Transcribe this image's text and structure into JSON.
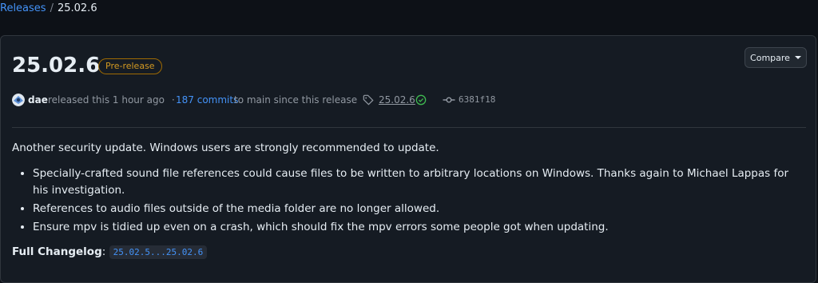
{
  "breadcrumb": {
    "parent": "Releases",
    "separator": "/",
    "current": "25.02.6"
  },
  "release": {
    "title": "25.02.6",
    "badge": "Pre-release",
    "compare_label": "Compare",
    "author": "dae",
    "released_text": "released this 1 hour ago",
    "dot": "·",
    "commits_link": "187 commits",
    "commits_suffix": "to main since this release",
    "tag": "25.02.6",
    "commit_sha": "6381f18"
  },
  "notes": {
    "intro": "Another security update. Windows users are strongly recommended to update.",
    "bullets": [
      "Specially-crafted sound file references could cause files to be written to arbitrary locations on Windows. Thanks again to Michael Lappas for his investigation.",
      "References to audio files outside of the media folder are no longer allowed.",
      "Ensure mpv is tidied up even on a crash, which should fix the mpv errors some people got when updating."
    ],
    "changelog_label": "Full Changelog",
    "changelog_colon": ":",
    "changelog_link": "25.02.5...25.02.6"
  },
  "colors": {
    "accent": "#4493f8",
    "prerelease": "#d29922",
    "verified": "#3fb950",
    "background": "#0d1117"
  }
}
